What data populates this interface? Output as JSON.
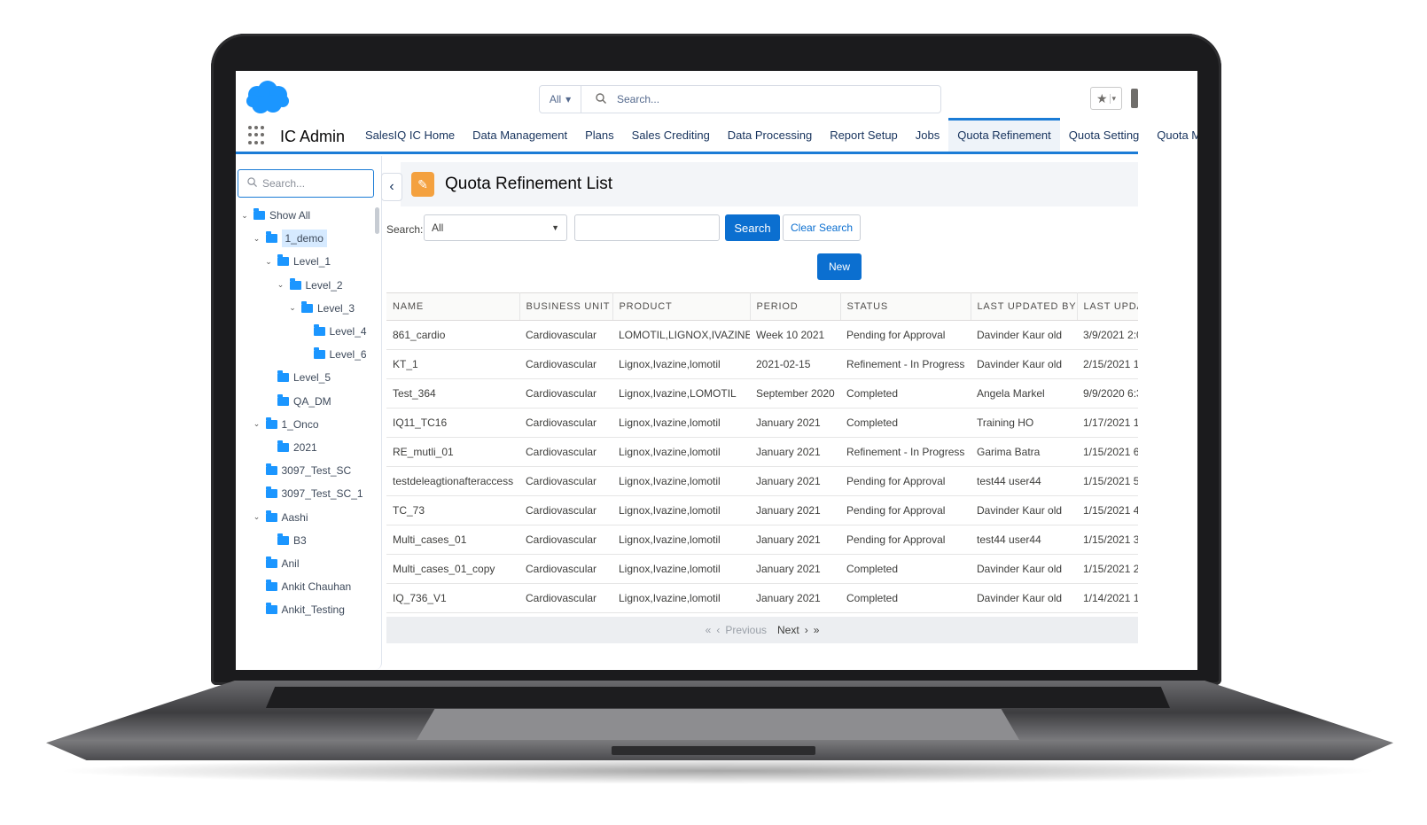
{
  "header": {
    "search_scope": "All",
    "search_placeholder": "Search..."
  },
  "app": {
    "name": "IC Admin"
  },
  "nav": {
    "tabs": [
      {
        "label": "SalesIQ IC Home"
      },
      {
        "label": "Data Management"
      },
      {
        "label": "Plans"
      },
      {
        "label": "Sales Crediting"
      },
      {
        "label": "Data Processing"
      },
      {
        "label": "Report Setup"
      },
      {
        "label": "Jobs"
      },
      {
        "label": "Quota Refinement",
        "active": true
      },
      {
        "label": "Quota Setting"
      },
      {
        "label": "Quota Master"
      }
    ]
  },
  "sidebar": {
    "search_placeholder": "Search...",
    "tree": [
      {
        "label": "Show All",
        "expanded": true,
        "level": 0
      },
      {
        "label": "1_demo",
        "expanded": true,
        "level": 1,
        "selected": true
      },
      {
        "label": "Level_1",
        "expanded": true,
        "level": 2
      },
      {
        "label": "Level_2",
        "expanded": true,
        "level": 3
      },
      {
        "label": "Level_3",
        "expanded": true,
        "level": 4
      },
      {
        "label": "Level_4",
        "level": 5
      },
      {
        "label": "Level_6",
        "level": 5
      },
      {
        "label": "Level_5",
        "level": 2
      },
      {
        "label": "QA_DM",
        "level": 2
      },
      {
        "label": "1_Onco",
        "expanded": true,
        "level": 1
      },
      {
        "label": "2021",
        "level": 2
      },
      {
        "label": "3097_Test_SC",
        "level": 1
      },
      {
        "label": "3097_Test_SC_1",
        "level": 1
      },
      {
        "label": "Aashi",
        "expanded": true,
        "level": 1
      },
      {
        "label": "B3",
        "level": 2
      },
      {
        "label": "Anil",
        "level": 1
      },
      {
        "label": "Ankit Chauhan",
        "level": 1
      },
      {
        "label": "Ankit_Testing",
        "level": 1
      }
    ]
  },
  "main": {
    "title": "Quota Refinement List",
    "filter_label": "Search:",
    "filter_value": "All",
    "search_button": "Search",
    "clear_button": "Clear Search",
    "new_button": "New",
    "columns": [
      "NAME",
      "BUSINESS UNIT",
      "PRODUCT",
      "PERIOD",
      "STATUS",
      "LAST UPDATED BY",
      "LAST UPDATED"
    ],
    "rows": [
      [
        "861_cardio",
        "Cardiovascular",
        "LOMOTIL,LIGNOX,IVAZINE",
        "Week 10 2021",
        "Pending for Approval",
        "Davinder Kaur old",
        "3/9/2021 2:0"
      ],
      [
        "KT_1",
        "Cardiovascular",
        "Lignox,Ivazine,lomotil",
        "2021-02-15",
        "Refinement - In Progress",
        "Davinder Kaur old",
        "2/15/2021 1"
      ],
      [
        "Test_364",
        "Cardiovascular",
        "Lignox,Ivazine,LOMOTIL",
        "September 2020",
        "Completed",
        "Angela Markel",
        "9/9/2020 6:3"
      ],
      [
        "IQ11_TC16",
        "Cardiovascular",
        "Lignox,Ivazine,lomotil",
        "January 2021",
        "Completed",
        "Training HO",
        "1/17/2021 1"
      ],
      [
        "RE_mutli_01",
        "Cardiovascular",
        "Lignox,Ivazine,lomotil",
        "January 2021",
        "Refinement - In Progress",
        "Garima Batra",
        "1/15/2021 6:"
      ],
      [
        "testdeleagtionafteraccess",
        "Cardiovascular",
        "Lignox,Ivazine,lomotil",
        "January 2021",
        "Pending for Approval",
        "test44 user44",
        "1/15/2021 5:"
      ],
      [
        "TC_73",
        "Cardiovascular",
        "Lignox,Ivazine,lomotil",
        "January 2021",
        "Pending for Approval",
        "Davinder Kaur old",
        "1/15/2021 4:"
      ],
      [
        "Multi_cases_01",
        "Cardiovascular",
        "Lignox,Ivazine,lomotil",
        "January 2021",
        "Pending for Approval",
        "test44 user44",
        "1/15/2021 3:"
      ],
      [
        "Multi_cases_01_copy",
        "Cardiovascular",
        "Lignox,Ivazine,lomotil",
        "January 2021",
        "Completed",
        "Davinder Kaur old",
        "1/15/2021 2:"
      ],
      [
        "IQ_736_V1",
        "Cardiovascular",
        "Lignox,Ivazine,lomotil",
        "January 2021",
        "Completed",
        "Davinder Kaur old",
        "1/14/2021 1("
      ]
    ],
    "pager": {
      "previous": "Previous",
      "next": "Next"
    }
  },
  "colors": {
    "brand": "#1b96ff",
    "accent": "#0b6fd0",
    "title_icon": "#f4a13f"
  }
}
